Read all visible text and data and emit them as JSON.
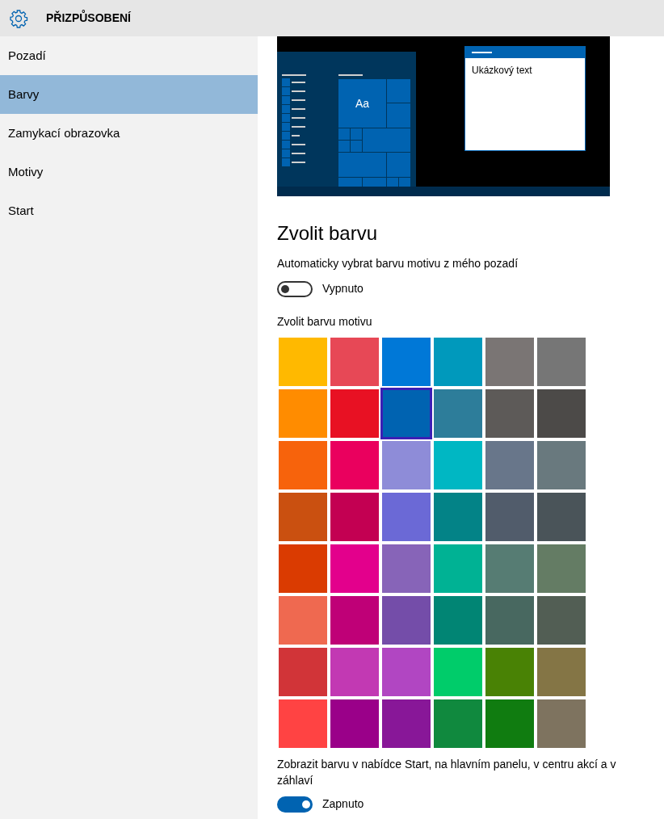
{
  "header": {
    "title": "PŘIZPŮSOBENÍ"
  },
  "sidebar": {
    "items": [
      {
        "label": "Pozadí",
        "selected": false
      },
      {
        "label": "Barvy",
        "selected": true
      },
      {
        "label": "Zamykací obrazovka",
        "selected": false
      },
      {
        "label": "Motivy",
        "selected": false
      },
      {
        "label": "Start",
        "selected": false
      }
    ]
  },
  "preview": {
    "tile_label": "Aa",
    "window_text": "Ukázkový text"
  },
  "section_title": "Zvolit barvu",
  "auto_color": {
    "label": "Automaticky vybrat barvu motivu z mého pozadí",
    "on": false,
    "state_text": "Vypnuto"
  },
  "palette": {
    "label": "Zvolit barvu motivu",
    "swatches": [
      {
        "color": "#ffb900",
        "selected": false
      },
      {
        "color": "#e74856",
        "selected": false
      },
      {
        "color": "#0078d7",
        "selected": false
      },
      {
        "color": "#0099bc",
        "selected": false
      },
      {
        "color": "#7a7574",
        "selected": false
      },
      {
        "color": "#767676",
        "selected": false
      },
      {
        "color": "#ff8c00",
        "selected": false
      },
      {
        "color": "#e81123",
        "selected": false
      },
      {
        "color": "#0063b1",
        "selected": true
      },
      {
        "color": "#2d7d9a",
        "selected": false
      },
      {
        "color": "#5d5a58",
        "selected": false
      },
      {
        "color": "#4c4a48",
        "selected": false
      },
      {
        "color": "#f7630c",
        "selected": false
      },
      {
        "color": "#ea005e",
        "selected": false
      },
      {
        "color": "#8e8cd8",
        "selected": false
      },
      {
        "color": "#00b7c3",
        "selected": false
      },
      {
        "color": "#68768a",
        "selected": false
      },
      {
        "color": "#69797e",
        "selected": false
      },
      {
        "color": "#ca5010",
        "selected": false
      },
      {
        "color": "#c30052",
        "selected": false
      },
      {
        "color": "#6b69d6",
        "selected": false
      },
      {
        "color": "#038387",
        "selected": false
      },
      {
        "color": "#515c6b",
        "selected": false
      },
      {
        "color": "#4a5459",
        "selected": false
      },
      {
        "color": "#da3b01",
        "selected": false
      },
      {
        "color": "#e3008c",
        "selected": false
      },
      {
        "color": "#8764b8",
        "selected": false
      },
      {
        "color": "#00b294",
        "selected": false
      },
      {
        "color": "#567c73",
        "selected": false
      },
      {
        "color": "#647c64",
        "selected": false
      },
      {
        "color": "#ef6950",
        "selected": false
      },
      {
        "color": "#bf0077",
        "selected": false
      },
      {
        "color": "#744da9",
        "selected": false
      },
      {
        "color": "#018574",
        "selected": false
      },
      {
        "color": "#486860",
        "selected": false
      },
      {
        "color": "#525e54",
        "selected": false
      },
      {
        "color": "#d13438",
        "selected": false
      },
      {
        "color": "#c239b3",
        "selected": false
      },
      {
        "color": "#b146c2",
        "selected": false
      },
      {
        "color": "#00cc6a",
        "selected": false
      },
      {
        "color": "#498205",
        "selected": false
      },
      {
        "color": "#847545",
        "selected": false
      },
      {
        "color": "#ff4343",
        "selected": false
      },
      {
        "color": "#9a0089",
        "selected": false
      },
      {
        "color": "#881798",
        "selected": false
      },
      {
        "color": "#10893e",
        "selected": false
      },
      {
        "color": "#107c10",
        "selected": false
      },
      {
        "color": "#7e735f",
        "selected": false
      }
    ]
  },
  "show_color": {
    "label": "Zobrazit barvu v nabídce Start, na hlavním panelu, v centru akcí a v záhlaví",
    "on": true,
    "state_text": "Zapnuto"
  }
}
